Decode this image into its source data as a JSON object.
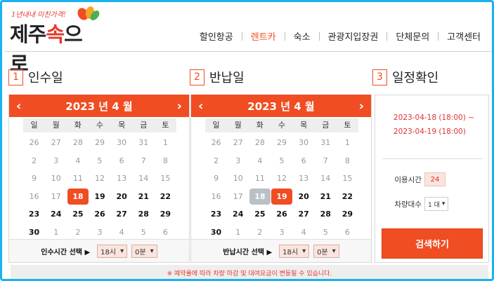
{
  "logo": {
    "tagline": "1년내내 미친가격!",
    "text_a": "제주",
    "text_b": "속",
    "text_c": "으로"
  },
  "nav": [
    "할인항공",
    "렌트카",
    "숙소",
    "관광지입장권",
    "단체문의",
    "고객센터"
  ],
  "colors": {
    "accent": "#f04d22",
    "frame": "#1ab2ef",
    "date_text": "#dd3333"
  },
  "sections": [
    {
      "num": "1",
      "title": "인수일"
    },
    {
      "num": "2",
      "title": "반납일"
    },
    {
      "num": "3",
      "title": "일정확인"
    }
  ],
  "calendar": {
    "title": "2023 년 4 월",
    "prev_icon": "chevron-left-icon",
    "next_icon": "chevron-right-icon",
    "dow": [
      "일",
      "월",
      "화",
      "수",
      "목",
      "금",
      "토"
    ],
    "days": [
      "26",
      "27",
      "28",
      "29",
      "30",
      "31",
      "1",
      "2",
      "3",
      "4",
      "5",
      "6",
      "7",
      "8",
      "9",
      "10",
      "11",
      "12",
      "13",
      "14",
      "15",
      "16",
      "17",
      "18",
      "19",
      "20",
      "21",
      "22",
      "23",
      "24",
      "25",
      "26",
      "27",
      "28",
      "29",
      "30",
      "1",
      "2",
      "3",
      "4",
      "5",
      "6"
    ],
    "prev": "‹",
    "next": "›"
  },
  "pickup": {
    "foot_label": "인수시간 선택 ▶",
    "hour": "18시",
    "minute": "0분"
  },
  "return": {
    "foot_label": "반납시간 선택 ▶",
    "hour": "18시",
    "minute": "0분"
  },
  "summary": {
    "date_from": "2023-04-18 (18:00) ~",
    "date_to": "2023-04-19 (18:00)",
    "use_time_label": "이용시간",
    "use_time_value": "24",
    "car_count_label": "차량대수",
    "car_count_value": "1 대",
    "search_button": "검색하기"
  },
  "notice": "※ 예약률에 따라 차량 마감 및 대여요금이 변동될 수 있습니다."
}
